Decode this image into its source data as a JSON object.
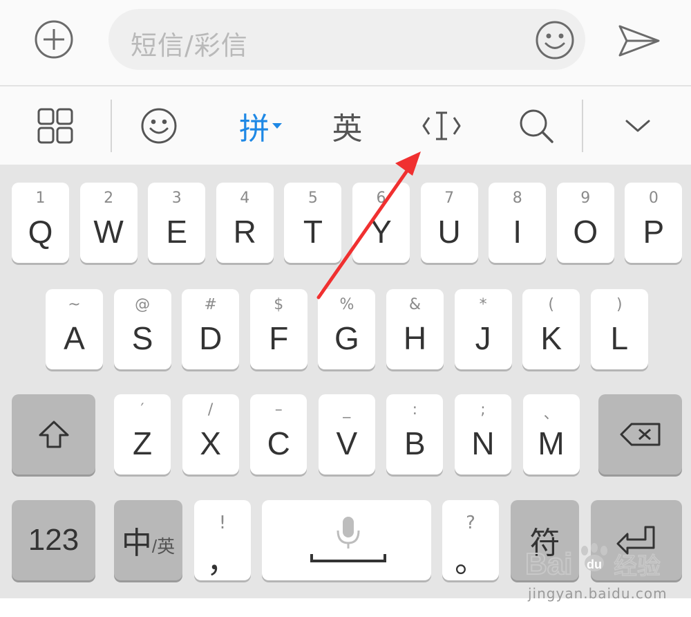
{
  "compose": {
    "input_placeholder": "短信/彩信",
    "icons": {
      "attach": "plus-circle-icon",
      "emoji": "smiley-icon",
      "send": "send-icon"
    }
  },
  "toolbar": {
    "pinyin_label": "拼",
    "english_label": "英",
    "accent_color": "#1e88e5",
    "icons": [
      "grid-icon",
      "smiley-icon",
      "cursor-move-icon",
      "search-icon",
      "chevron-down-icon"
    ]
  },
  "keyboard": {
    "row1": [
      {
        "main": "Q",
        "sub": "1"
      },
      {
        "main": "W",
        "sub": "2"
      },
      {
        "main": "E",
        "sub": "3"
      },
      {
        "main": "R",
        "sub": "4"
      },
      {
        "main": "T",
        "sub": "5"
      },
      {
        "main": "Y",
        "sub": "6"
      },
      {
        "main": "U",
        "sub": "7"
      },
      {
        "main": "I",
        "sub": "8"
      },
      {
        "main": "O",
        "sub": "9"
      },
      {
        "main": "P",
        "sub": "0"
      }
    ],
    "row2": [
      {
        "main": "A",
        "sub": "~"
      },
      {
        "main": "S",
        "sub": "@"
      },
      {
        "main": "D",
        "sub": "#"
      },
      {
        "main": "F",
        "sub": "$"
      },
      {
        "main": "G",
        "sub": "%"
      },
      {
        "main": "H",
        "sub": "&"
      },
      {
        "main": "J",
        "sub": "*"
      },
      {
        "main": "K",
        "sub": "("
      },
      {
        "main": "L",
        "sub": ")"
      }
    ],
    "row3": [
      {
        "main": "Z",
        "sub": "′"
      },
      {
        "main": "X",
        "sub": "/"
      },
      {
        "main": "C",
        "sub": "–"
      },
      {
        "main": "V",
        "sub": "_"
      },
      {
        "main": "B",
        "sub": ":"
      },
      {
        "main": "N",
        "sub": ";"
      },
      {
        "main": "M",
        "sub": "、"
      }
    ],
    "num_label": "123",
    "zh_label": "中",
    "en_small_label": "/英",
    "comma_main": "，",
    "comma_sub": "!",
    "period_main": "。",
    "period_sub": "?",
    "symbol_label": "符"
  },
  "watermark": {
    "logo_text": "Bai du 经验",
    "url": "jingyan.baidu.com"
  },
  "annotation": {
    "arrow_color": "#f03030"
  }
}
